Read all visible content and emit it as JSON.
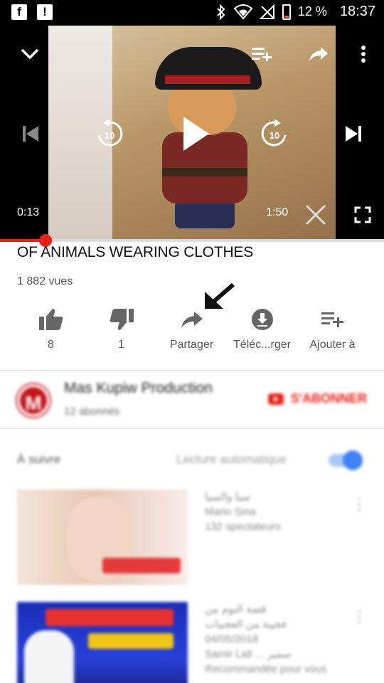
{
  "status_bar": {
    "battery": "12 %",
    "time": "18:37",
    "left_icons": [
      "f",
      "!"
    ],
    "icons": [
      "bluetooth-icon",
      "wifi-icon",
      "no-signal-icon",
      "battery-icon"
    ]
  },
  "video": {
    "elapsed": "0:13",
    "duration": "1:50",
    "progress": 0.118,
    "controls": [
      "chevron-down-icon",
      "add-to-playlist-icon",
      "share-icon",
      "more-vert-icon",
      "previous-icon",
      "rewind-10-icon",
      "play-icon",
      "forward-10-icon",
      "next-icon",
      "close-icon",
      "fullscreen-icon"
    ],
    "replay_label": "10",
    "forward_label": "10"
  },
  "info": {
    "title": "OF ANIMALS WEARING CLOTHES",
    "views": "1 882 vues"
  },
  "actions": [
    {
      "icon": "thumbs-up-icon",
      "label": "8"
    },
    {
      "icon": "thumbs-down-icon",
      "label": "1"
    },
    {
      "icon": "share-icon",
      "label": "Partager"
    },
    {
      "icon": "download-icon",
      "label": "Téléc...rger"
    },
    {
      "icon": "add-to-playlist-icon",
      "label": "Ajouter à"
    }
  ],
  "channel": {
    "avatar_letter": "M",
    "name": "Mas Kupiw Production",
    "subscribers": "12 abonnés",
    "subscribe_label": "S'ABONNER"
  },
  "up_next": {
    "label": "À suivre",
    "autoplay_label": "Lecture automatique",
    "autoplay_on": true
  },
  "recommendations": [
    {
      "lines": [
        "سيا والسيا",
        "Mario Sina",
        "132 spectateurs"
      ]
    },
    {
      "lines": [
        "قضة النوم من",
        "عجيبة من العجيبات",
        "04/05/2018",
        "Samir Lali ... سمير",
        "Recommandée pour vous"
      ]
    }
  ],
  "colors": {
    "accent_red": "#e62117",
    "toggle_blue": "#3e82f7"
  }
}
